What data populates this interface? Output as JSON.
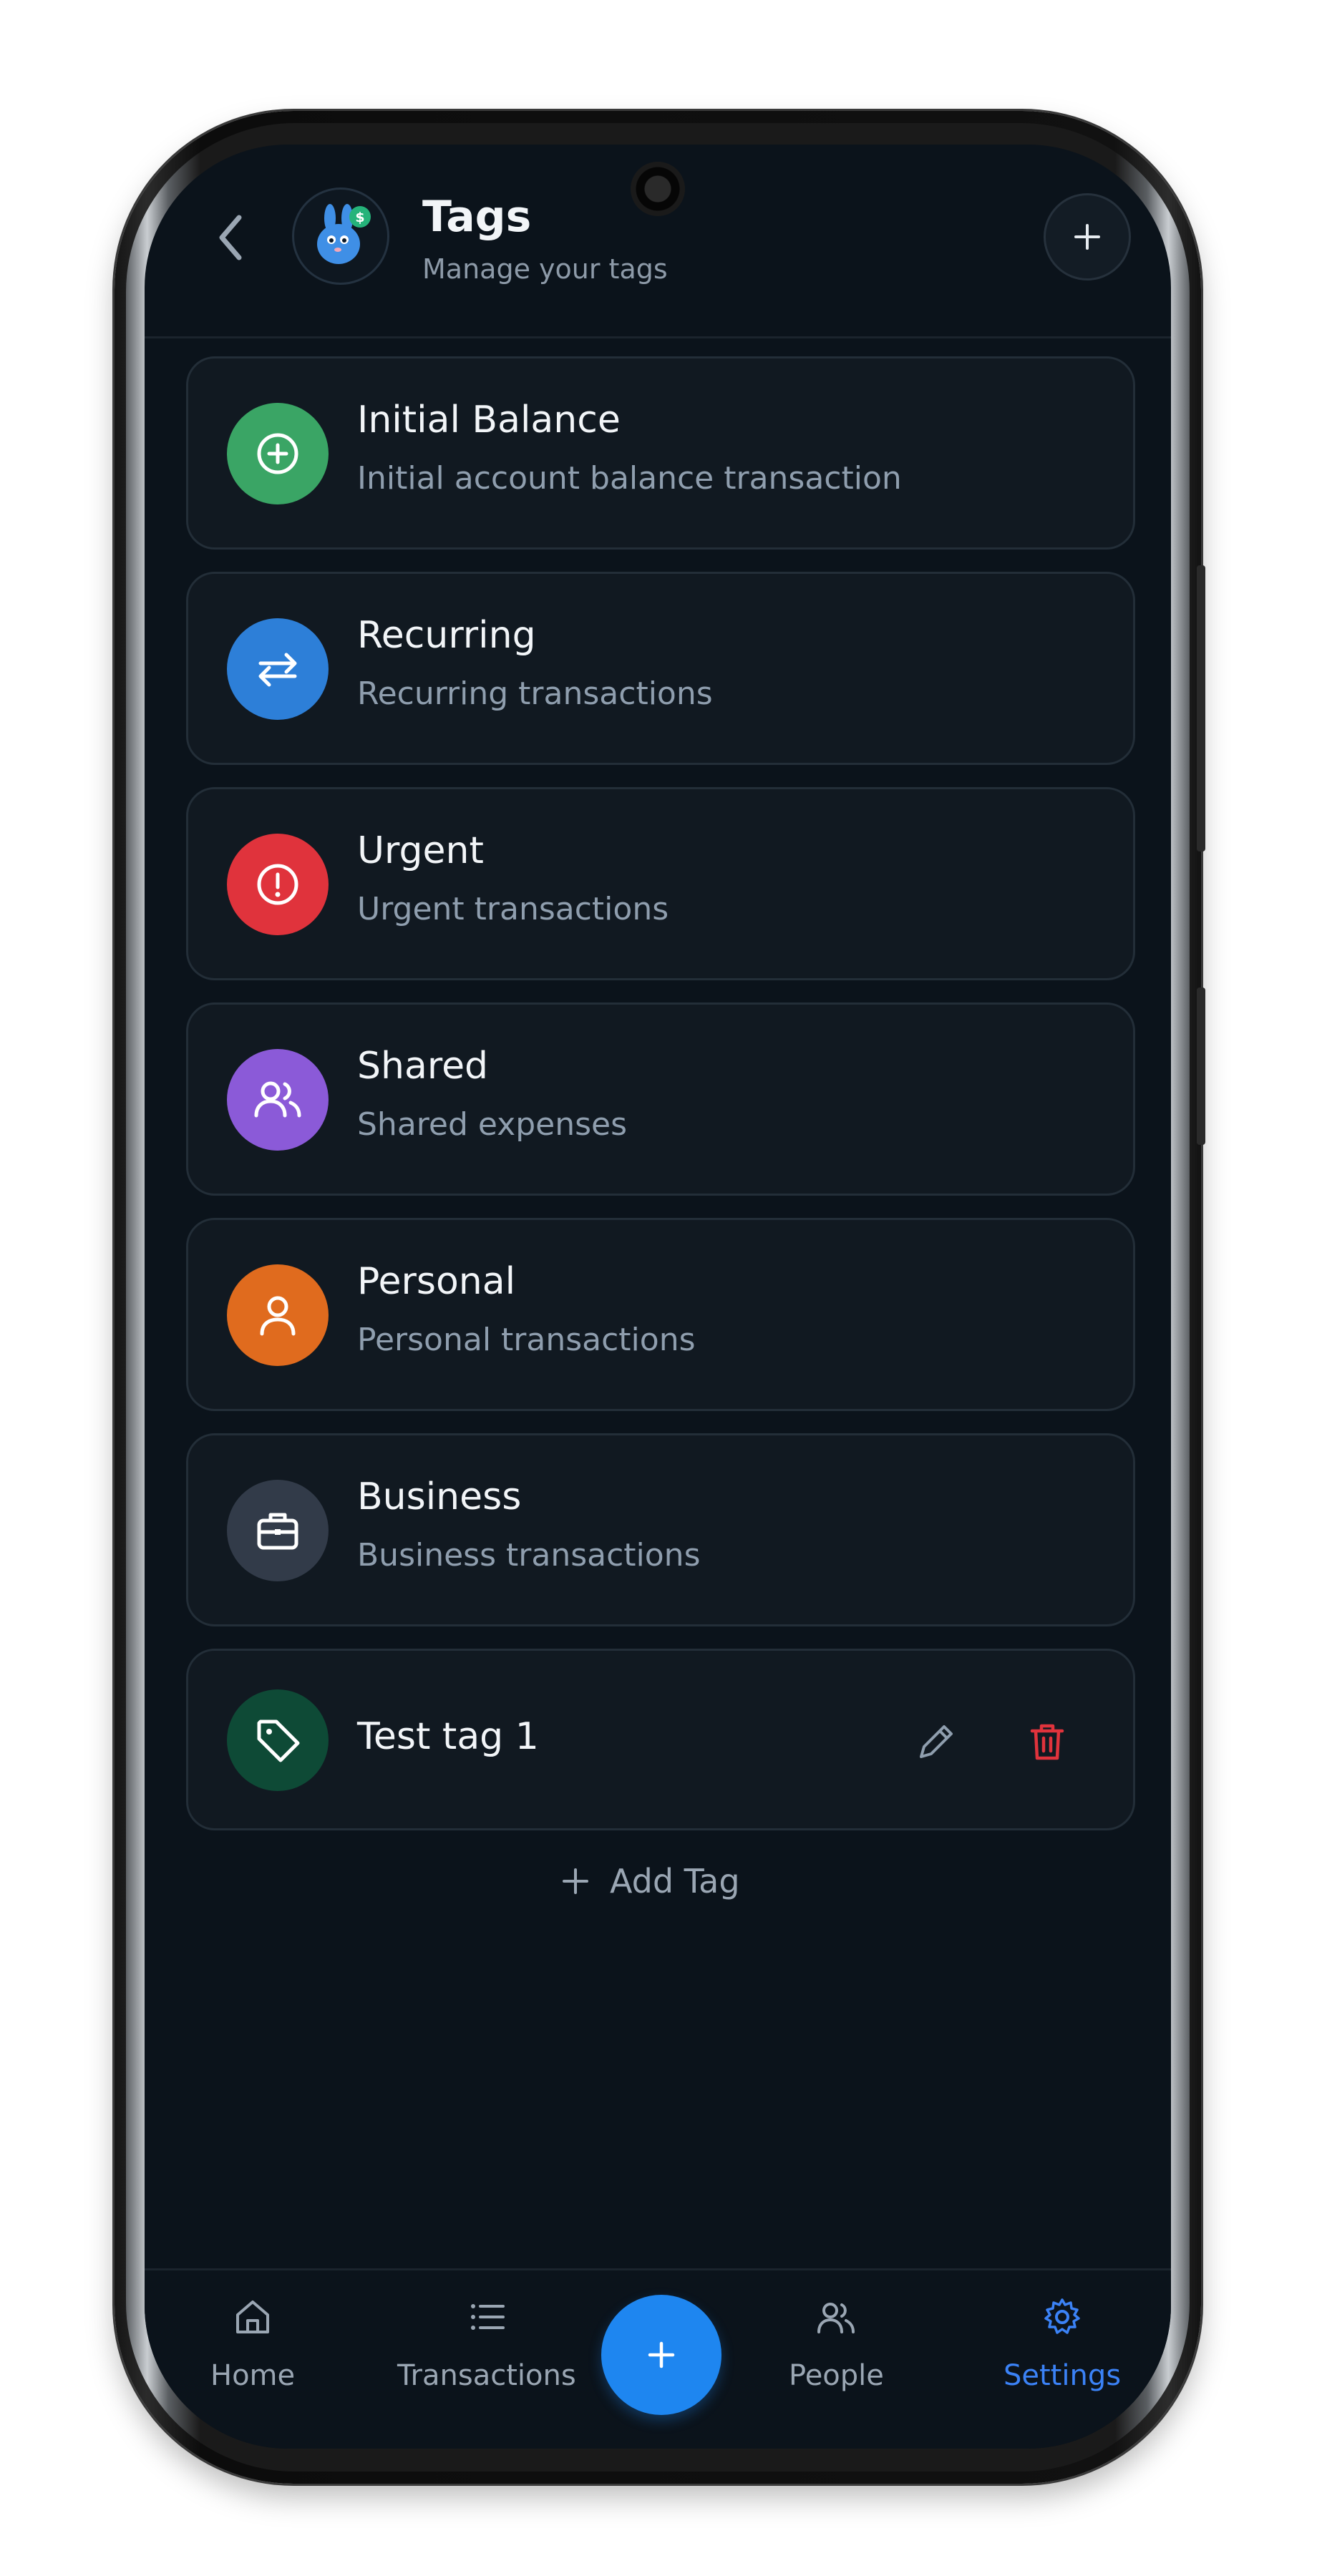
{
  "header": {
    "title": "Tags",
    "subtitle": "Manage your tags",
    "back_icon": "chevron-left-icon",
    "add_icon": "plus-icon",
    "avatar_badge": "$"
  },
  "tags": [
    {
      "name": "Initial Balance",
      "description": "Initial account balance transaction",
      "icon": "plus-circle-icon",
      "color": "#3aa565"
    },
    {
      "name": "Recurring",
      "description": "Recurring transactions",
      "icon": "repeat-icon",
      "color": "#2d7fd8"
    },
    {
      "name": "Urgent",
      "description": "Urgent transactions",
      "icon": "alert-circle-icon",
      "color": "#e0333c"
    },
    {
      "name": "Shared",
      "description": "Shared expenses",
      "icon": "users-icon",
      "color": "#8b5ad8"
    },
    {
      "name": "Personal",
      "description": "Personal transactions",
      "icon": "user-icon",
      "color": "#e06b1e"
    },
    {
      "name": "Business",
      "description": "Business transactions",
      "icon": "briefcase-icon",
      "color": "#323b49"
    },
    {
      "name": "Test tag 1",
      "icon": "tag-icon",
      "color": "#0e4a36",
      "actions": [
        "edit-icon",
        "trash-icon"
      ]
    }
  ],
  "add_tag_label": "Add Tag",
  "nav": {
    "items": [
      {
        "label": "Home",
        "icon": "home-icon"
      },
      {
        "label": "Transactions",
        "icon": "list-icon"
      },
      {
        "label": "People",
        "icon": "users-icon"
      },
      {
        "label": "Settings",
        "icon": "settings-icon",
        "active": true
      }
    ],
    "fab_icon": "plus-icon"
  },
  "colors": {
    "background": "#0b131b",
    "card": "#111921",
    "accent": "#1e86f0",
    "active_nav": "#3b82f6",
    "danger": "#e0333c"
  }
}
